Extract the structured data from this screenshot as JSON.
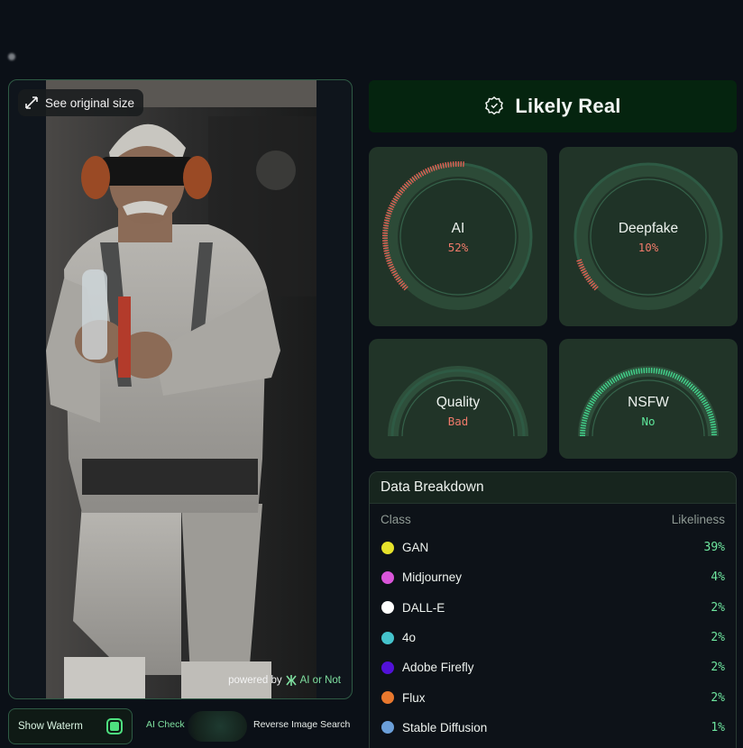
{
  "image_panel": {
    "see_original_label": "See original size",
    "powered_by_prefix": "powered by",
    "powered_by_brand": "AI or Not"
  },
  "controls": {
    "show_watermark_label": "Show Waterm",
    "ai_check_label": "AI Check",
    "reverse_search_label": "Reverse Image Search"
  },
  "verdict": {
    "label": "Likely Real",
    "icon": "badge-icon"
  },
  "gauges": {
    "ai": {
      "title": "AI",
      "value": "52%",
      "level": 0.52,
      "color": "#e05f52"
    },
    "deepfake": {
      "title": "Deepfake",
      "value": "10%",
      "level": 0.1,
      "color": "#e05f52"
    },
    "quality": {
      "title": "Quality",
      "value": "Bad",
      "level": 0.0,
      "color": "#e05f52"
    },
    "nsfw": {
      "title": "NSFW",
      "value": "No",
      "level": 1.0,
      "color": "#43d28a"
    }
  },
  "breakdown": {
    "title": "Data Breakdown",
    "col_class": "Class",
    "col_likeliness": "Likeliness",
    "rows": [
      {
        "name": "GAN",
        "pct": "39%",
        "color": "#e6e22b"
      },
      {
        "name": "Midjourney",
        "pct": "4%",
        "color": "#d955d9"
      },
      {
        "name": "DALL-E",
        "pct": "2%",
        "color": "#ffffff"
      },
      {
        "name": "4o",
        "pct": "2%",
        "color": "#45c3cc"
      },
      {
        "name": "Adobe Firefly",
        "pct": "2%",
        "color": "#5211d8"
      },
      {
        "name": "Flux",
        "pct": "2%",
        "color": "#e8782e"
      },
      {
        "name": "Stable Diffusion",
        "pct": "1%",
        "color": "#6b9fd9"
      }
    ]
  }
}
